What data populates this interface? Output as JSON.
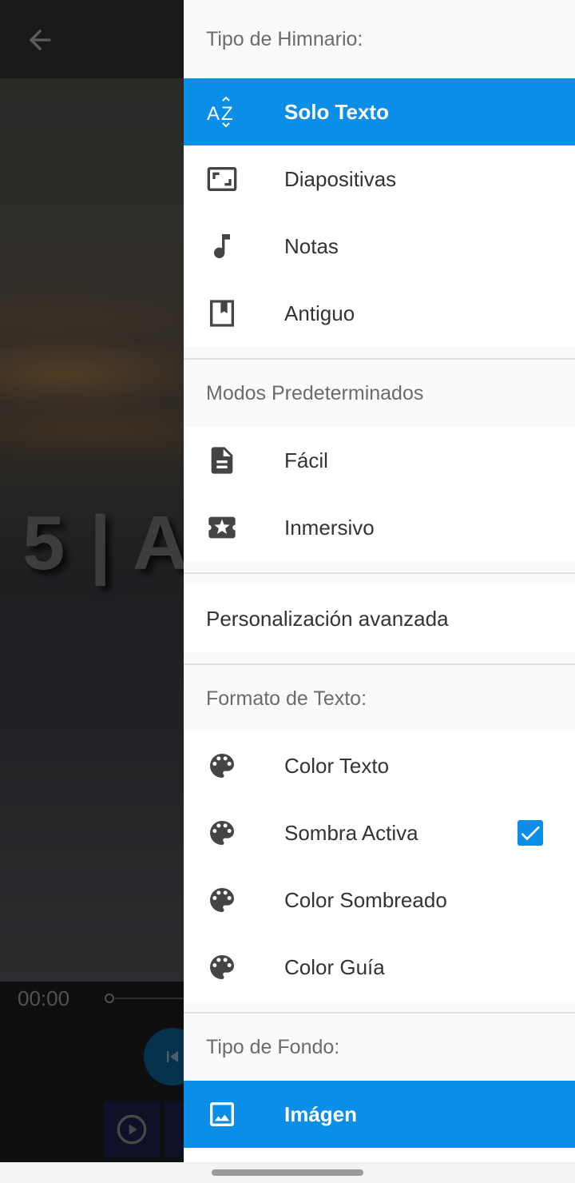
{
  "background": {
    "overlay_text": "5 | A",
    "time_elapsed": "00:00"
  },
  "drawer": {
    "sections": [
      {
        "header": "Tipo de Himnario:",
        "items": [
          {
            "label": "Solo Texto",
            "icon": "sort-az-icon",
            "active": true
          },
          {
            "label": "Diapositivas",
            "icon": "slides-icon",
            "active": false
          },
          {
            "label": "Notas",
            "icon": "music-note-icon",
            "active": false
          },
          {
            "label": "Antiguo",
            "icon": "book-icon",
            "active": false
          }
        ]
      },
      {
        "header": "Modos Predeterminados",
        "items": [
          {
            "label": "Fácil",
            "icon": "document-icon",
            "active": false
          },
          {
            "label": "Inmersivo",
            "icon": "star-ticket-icon",
            "active": false
          }
        ]
      },
      {
        "header": "",
        "items": [
          {
            "label": "Personalización avanzada",
            "icon": "",
            "active": false
          }
        ]
      },
      {
        "header": "Formato de Texto:",
        "items": [
          {
            "label": "Color Texto",
            "icon": "palette-icon",
            "active": false
          },
          {
            "label": "Sombra Activa",
            "icon": "palette-icon",
            "active": false,
            "checked": true
          },
          {
            "label": "Color Sombreado",
            "icon": "palette-icon",
            "active": false
          },
          {
            "label": "Color Guía",
            "icon": "palette-icon",
            "active": false
          }
        ]
      },
      {
        "header": "Tipo de Fondo:",
        "items": [
          {
            "label": "Imágen",
            "icon": "image-icon",
            "active": true
          }
        ]
      }
    ]
  },
  "colors": {
    "accent": "#0b8ee8",
    "text": "#333333",
    "header_text": "#6b6b6b",
    "icon": "#444444"
  }
}
